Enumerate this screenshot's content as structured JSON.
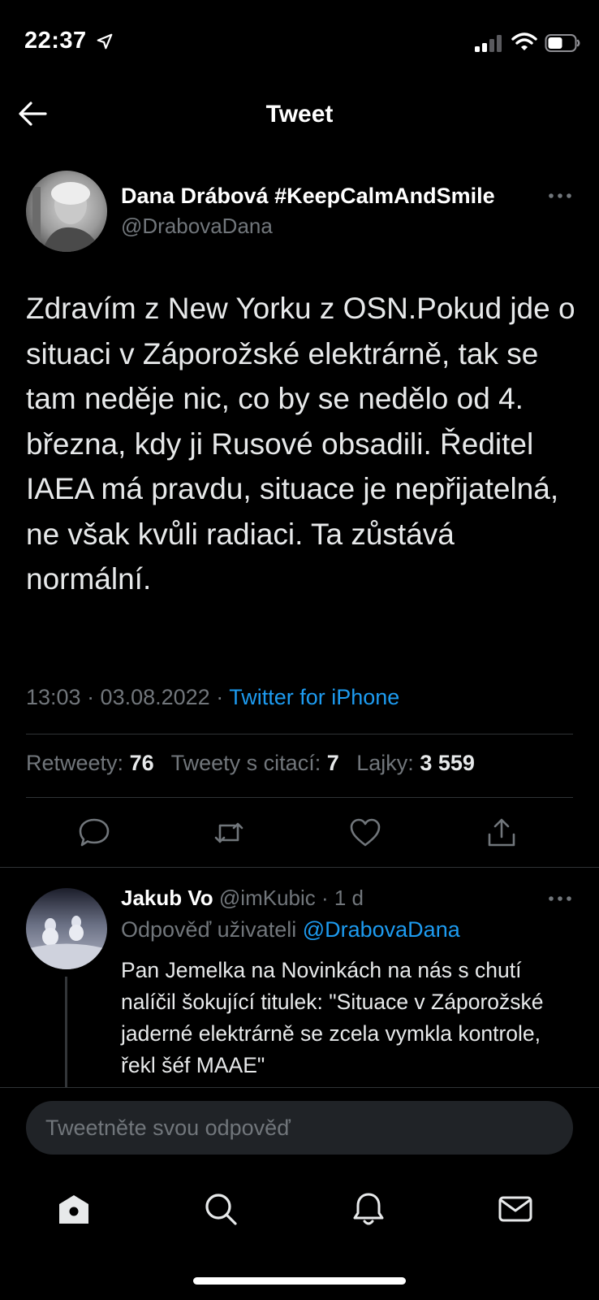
{
  "status": {
    "time": "22:37"
  },
  "header": {
    "title": "Tweet"
  },
  "tweet": {
    "author_name": "Dana Drábová #KeepCalmAndSmile",
    "author_handle": "@DrabovaDana",
    "text": "Zdravím z New Yorku z OSN.Pokud jde o situaci v Záporožské elektrárně, tak se tam neděje nic, co by se nedělo od 4. března, kdy ji Rusové obsadili. Ředitel IAEA má pravdu, situace je nepřijatelná, ne však kvůli radiaci. Ta zůstává normální.",
    "datetime": "13:03 · 03.08.2022 · ",
    "source": "Twitter for iPhone",
    "stats": {
      "retweets_label": "Retweety:",
      "retweets": "76",
      "quotes_label": "Tweety s citací:",
      "quotes": "7",
      "likes_label": "Lajky:",
      "likes": "3 559"
    }
  },
  "reply": {
    "name": "Jakub Vo",
    "handle_time": " @imKubic · 1 d",
    "reply_to_label": "Odpověď uživateli ",
    "reply_to_handle": "@DrabovaDana",
    "text": "Pan Jemelka na Novinkách na nás s chutí nalíčil šokující titulek: \"Situace v Záporožské jaderné elektrárně se zcela vymkla kontrole, řekl šéf MAAE\""
  },
  "composer": {
    "placeholder": "Tweetněte svou odpověď"
  },
  "icons": {
    "actions": [
      "reply-icon",
      "retweet-icon",
      "like-icon",
      "share-icon"
    ],
    "tabs": [
      "home-icon",
      "search-icon",
      "notifications-icon",
      "messages-icon"
    ]
  },
  "colors": {
    "accent": "#1d9bf0",
    "background": "#000000",
    "muted": "#71767b"
  }
}
